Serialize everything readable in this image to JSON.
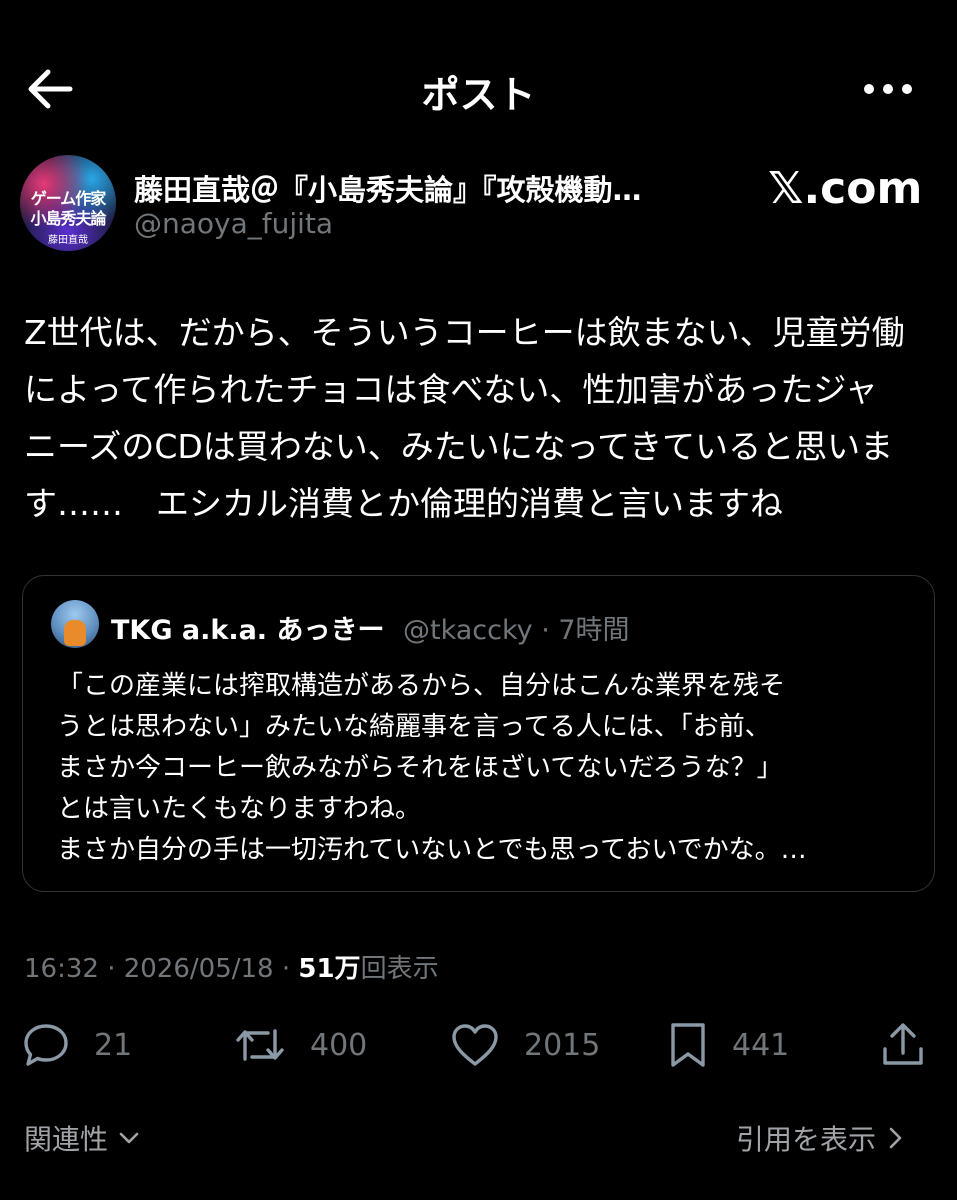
{
  "header": {
    "title": "ポスト",
    "back_icon": "arrow-left-icon",
    "more_icon": "more-horizontal-icon"
  },
  "author": {
    "display_name": "藤田直哉＠『小島秀夫論』『攻殻機動…",
    "handle": "@naoya_fujita",
    "avatar_text": {
      "line1": "ゲーム作家",
      "line2": "小島秀夫論",
      "line3": "藤田直哉"
    },
    "watermark": "𝕏.com"
  },
  "post": {
    "text": "Z世代は、だから、そういうコーヒーは飲まない、児童労働\nによって作られたチョコは食べない、性加害があったジャ\nニーズのCDは買わない、みたいになってきていると思いま\nす……　エシカル消費とか倫理的消費と言いますね"
  },
  "quote": {
    "name": "TKG a.k.a. あっきー",
    "meta": "@tkaccky · 7時間",
    "text": "「この産業には搾取構造があるから、自分はこんな業界を残そ\nうとは思わない」みたいな綺麗事を言ってる人には、「お前、\nまさか今コーヒー飲みながらそれをほざいてないだろうな？」\nとは言いたくもなりますわね。\nまさか自分の手は一切汚れていないとでも思っておいでかな。…"
  },
  "meta": {
    "timestamp": "16:32 · 2026/05/18 · ",
    "views_count": "51万",
    "views_label": "回表示"
  },
  "actions": {
    "reply_count": "21",
    "retweet_count": "400",
    "like_count": "2015",
    "bookmark_count": "441"
  },
  "footer": {
    "related_label": "関連性",
    "quotes_label": "引用を表示"
  },
  "colors": {
    "background": "#000000",
    "text_primary": "#e7e9ea",
    "text_secondary": "#71767b",
    "border": "#2f3336"
  }
}
